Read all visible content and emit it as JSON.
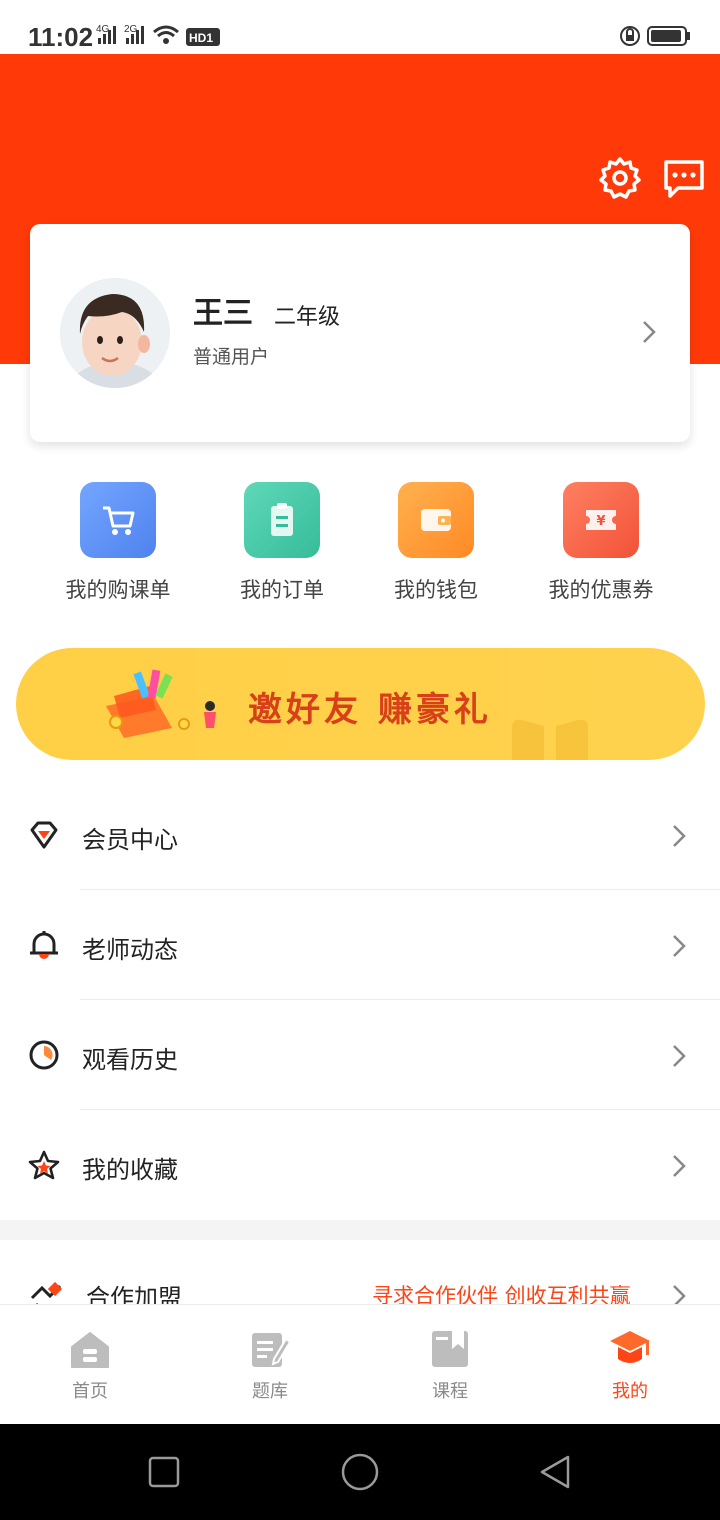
{
  "status_bar": {
    "time": "11:02",
    "signal_1": "4G",
    "signal_2": "2G",
    "hd": "HD1"
  },
  "profile": {
    "name": "王三",
    "grade": "二年级",
    "user_type": "普通用户"
  },
  "quick_actions": [
    {
      "label": "我的购课单",
      "icon": "cart-icon",
      "color": "#5b8ff5"
    },
    {
      "label": "我的订单",
      "icon": "clipboard-icon",
      "color": "#3fc5a4"
    },
    {
      "label": "我的钱包",
      "icon": "wallet-icon",
      "color": "#ff9a34"
    },
    {
      "label": "我的优惠券",
      "icon": "coupon-icon",
      "color": "#ff6a45"
    }
  ],
  "banner": {
    "text": "邀好友 赚豪礼"
  },
  "menu": [
    {
      "label": "会员中心",
      "icon": "diamond-icon"
    },
    {
      "label": "老师动态",
      "icon": "bell-icon"
    },
    {
      "label": "观看历史",
      "icon": "clock-icon"
    },
    {
      "label": "我的收藏",
      "icon": "star-icon"
    }
  ],
  "partner": {
    "label": "合作加盟",
    "promo": "寻求合作伙伴 创收互利共赢"
  },
  "tabs": [
    {
      "label": "首页",
      "icon": "home-icon"
    },
    {
      "label": "题库",
      "icon": "question-bank-icon"
    },
    {
      "label": "课程",
      "icon": "course-icon"
    },
    {
      "label": "我的",
      "icon": "graduation-cap-icon",
      "active": true
    }
  ],
  "colors": {
    "brand": "#ff3a08",
    "accent_text": "#ff4416",
    "banner": "#ffd24e"
  }
}
